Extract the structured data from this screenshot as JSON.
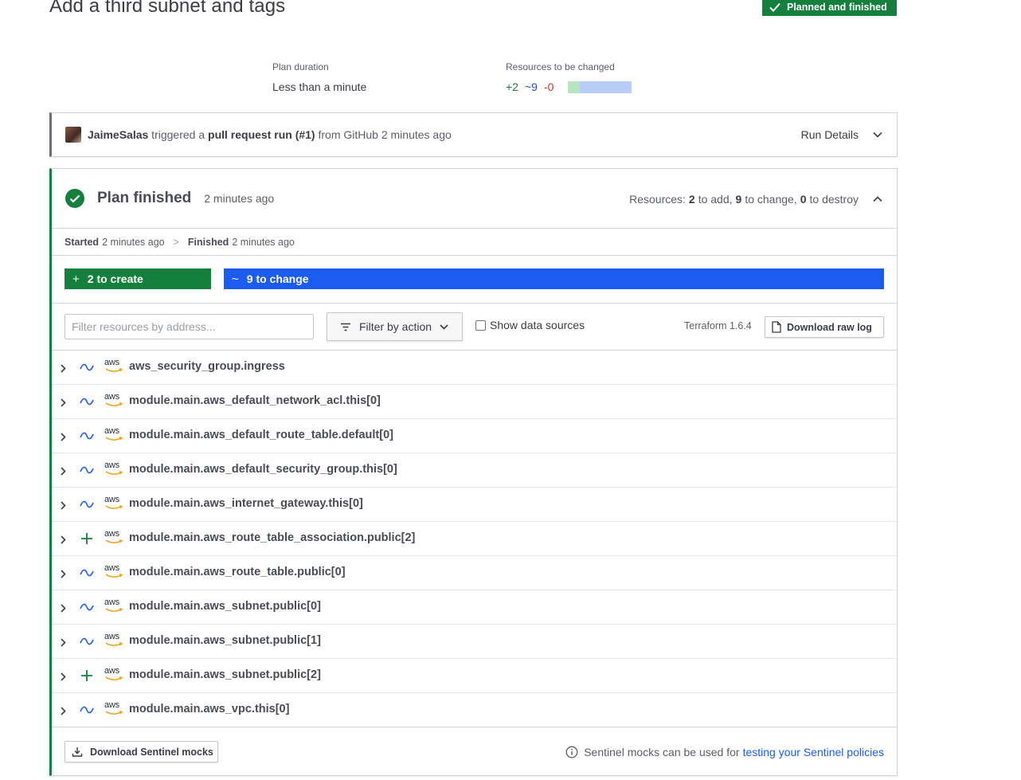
{
  "header": {
    "title": "Add a third subnet and tags",
    "status_badge": "Planned and finished"
  },
  "meta": {
    "plan_duration_label": "Plan duration",
    "plan_duration_value": "Less than a minute",
    "resources_label": "Resources to be changed",
    "add_count": "+2",
    "change_count": "~9",
    "destroy_count": "-0"
  },
  "run": {
    "user": "JaimeSalas",
    "triggered_text": " triggered a ",
    "run_type": "pull request run (#1)",
    "source_text": " from GitHub 2 minutes ago",
    "details_label": "Run Details"
  },
  "plan": {
    "title": "Plan finished",
    "time": "2 minutes ago",
    "resources_prefix": "Resources:",
    "add_n": "2",
    "add_text": "to add,",
    "change_n": "9",
    "change_text": "to change,",
    "destroy_n": "0",
    "destroy_text": "to destroy",
    "started_label": "Started",
    "started_value": "2 minutes ago",
    "finished_label": "Finished",
    "finished_value": "2 minutes ago",
    "create_summary": "2 to create",
    "change_summary": "9 to change"
  },
  "toolbar": {
    "filter_placeholder": "Filter resources by address...",
    "filter_action_label": "Filter by action",
    "show_data_sources_label": "Show data sources",
    "terraform_version": "Terraform 1.6.4",
    "download_raw_log_label": "Download raw log"
  },
  "resources": [
    {
      "action": "change",
      "provider": "aws",
      "name": "aws_security_group.ingress"
    },
    {
      "action": "change",
      "provider": "aws",
      "name": "module.main.aws_default_network_acl.this[0]"
    },
    {
      "action": "change",
      "provider": "aws",
      "name": "module.main.aws_default_route_table.default[0]"
    },
    {
      "action": "change",
      "provider": "aws",
      "name": "module.main.aws_default_security_group.this[0]"
    },
    {
      "action": "change",
      "provider": "aws",
      "name": "module.main.aws_internet_gateway.this[0]"
    },
    {
      "action": "create",
      "provider": "aws",
      "name": "module.main.aws_route_table_association.public[2]"
    },
    {
      "action": "change",
      "provider": "aws",
      "name": "module.main.aws_route_table.public[0]"
    },
    {
      "action": "change",
      "provider": "aws",
      "name": "module.main.aws_subnet.public[0]"
    },
    {
      "action": "change",
      "provider": "aws",
      "name": "module.main.aws_subnet.public[1]"
    },
    {
      "action": "create",
      "provider": "aws",
      "name": "module.main.aws_subnet.public[2]"
    },
    {
      "action": "change",
      "provider": "aws",
      "name": "module.main.aws_vpc.this[0]"
    }
  ],
  "footer": {
    "download_mocks_label": "Download Sentinel mocks",
    "mocks_info_text": "Sentinel mocks can be used for",
    "mocks_link_text": "testing your Sentinel policies"
  },
  "icons": {
    "status": "check-icon",
    "chevron": "chevron-down-icon",
    "collapse": "chevron-up-icon",
    "row_expand": "chevron-right-icon",
    "change_action": "tilde-icon",
    "create_action": "plus-icon",
    "provider": "aws-logo-icon",
    "filter": "filter-lines-icon",
    "file": "file-icon",
    "download": "download-icon",
    "info": "info-icon"
  },
  "colors": {
    "create": "#15803d",
    "change": "#1c5cf0",
    "destroy": "#c0392b",
    "create_bar": "#b7e5c0",
    "change_bar": "#b7cdf8"
  }
}
